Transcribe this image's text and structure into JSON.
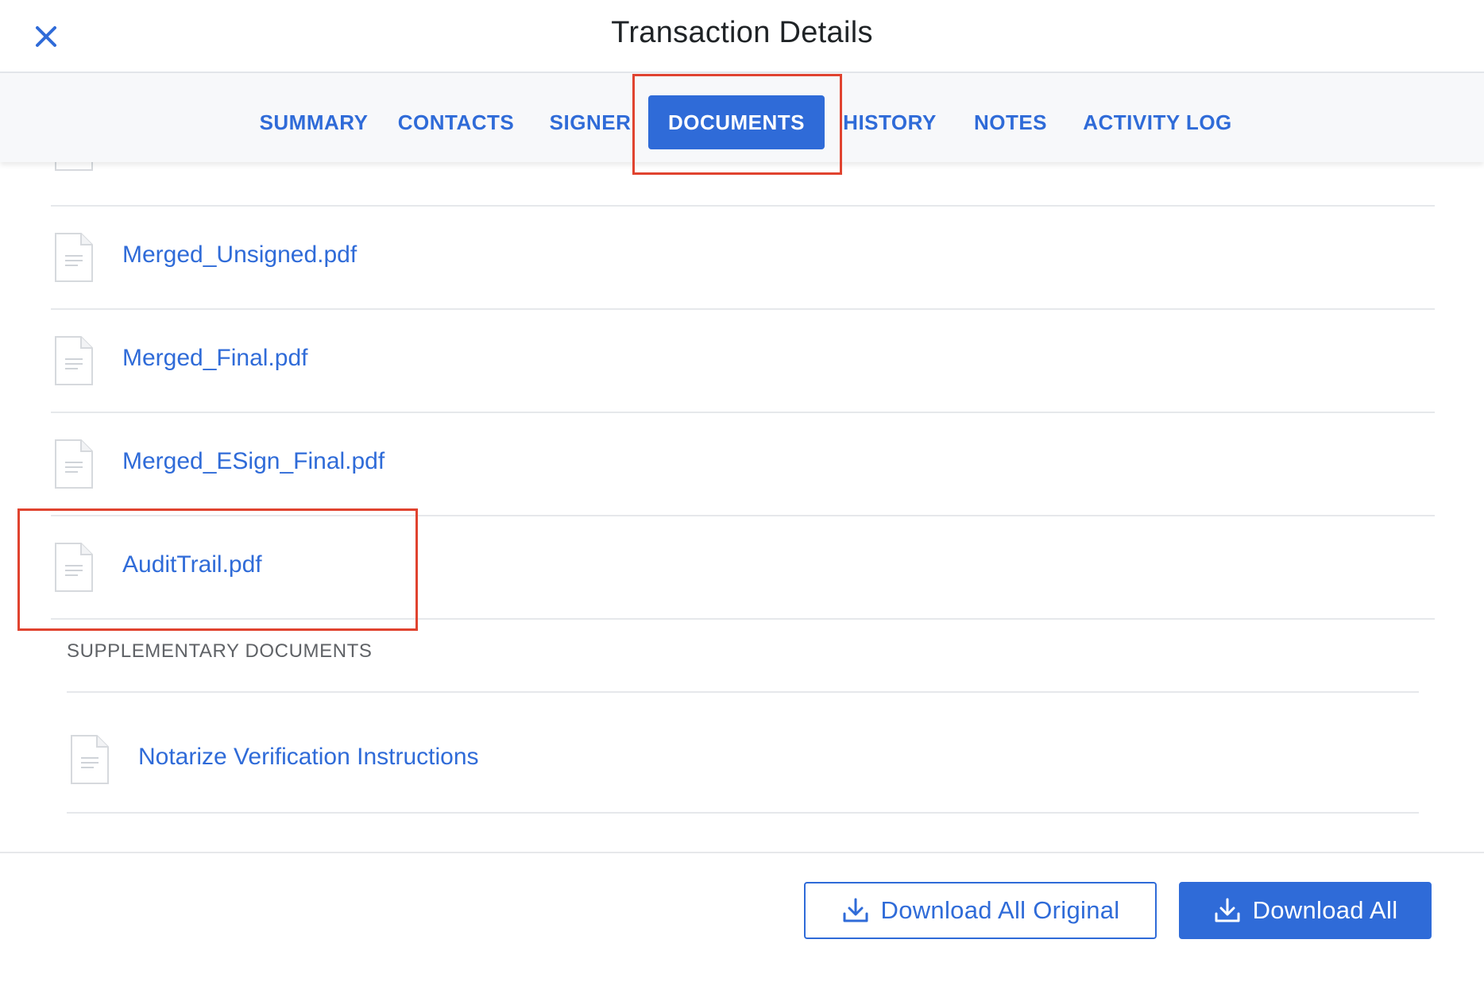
{
  "header": {
    "title": "Transaction Details",
    "close_icon": "close-icon"
  },
  "tabs": [
    {
      "label": "SUMMARY",
      "active": false
    },
    {
      "label": "CONTACTS",
      "active": false
    },
    {
      "label": "SIGNER",
      "active": false
    },
    {
      "label": "DOCUMENTS",
      "active": true
    },
    {
      "label": "HISTORY",
      "active": false
    },
    {
      "label": "NOTES",
      "active": false
    },
    {
      "label": "ACTIVITY LOG",
      "active": false
    }
  ],
  "documents": [
    {
      "name": "Merged_Unsigned.pdf"
    },
    {
      "name": "Merged_Final.pdf"
    },
    {
      "name": "Merged_ESign_Final.pdf"
    },
    {
      "name": "AuditTrail.pdf"
    }
  ],
  "supplementary": {
    "label": "SUPPLEMENTARY DOCUMENTS",
    "items": [
      {
        "name": "Notarize Verification Instructions"
      }
    ]
  },
  "footer": {
    "download_all_original_label": "Download All Original",
    "download_all_label": "Download All",
    "download_icon": "download-icon"
  },
  "colors": {
    "accent": "#2f6bd8",
    "highlight": "#e0432f",
    "text_dark": "#1f2326",
    "muted": "#5f6266"
  }
}
